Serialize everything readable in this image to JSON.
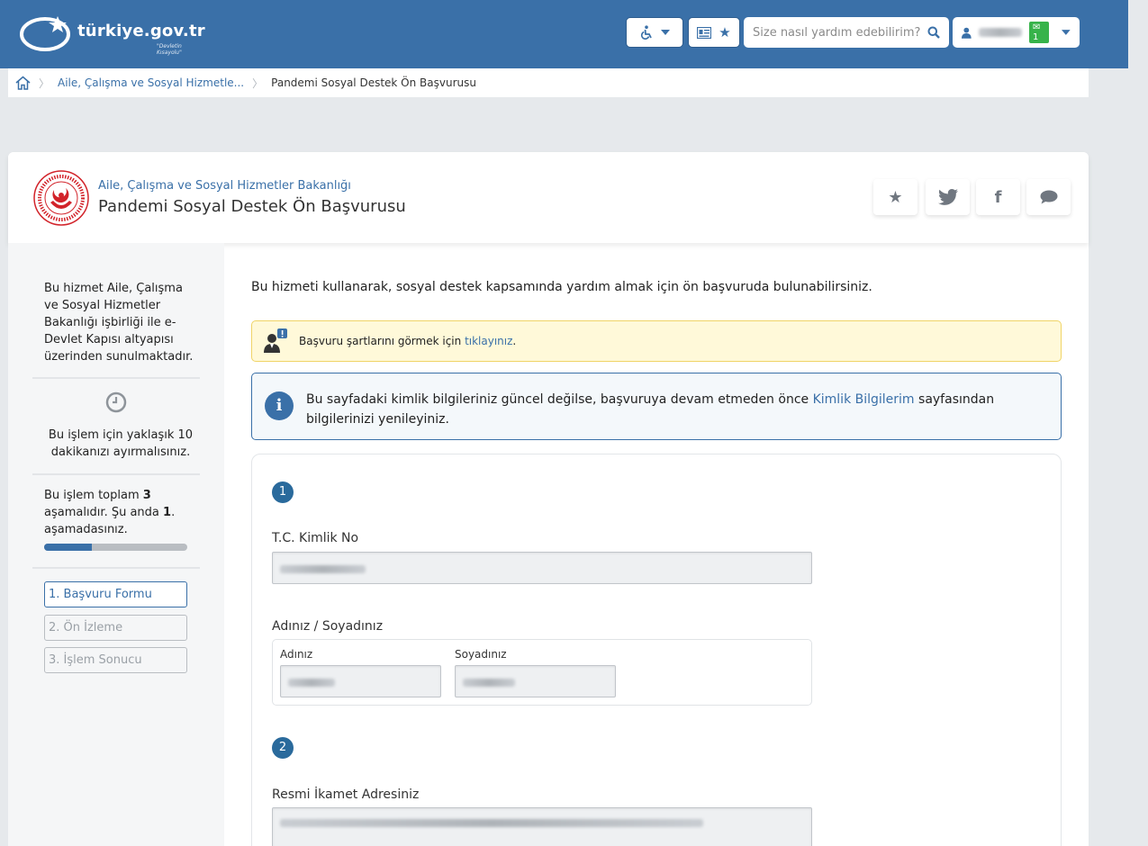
{
  "header": {
    "logo_text": "türkiye.gov.tr",
    "logo_sub": "\"Devletin Kısayolu\"",
    "accessibility_icon": "wheelchair-icon",
    "search_placeholder": "Size nasıl yardım edebilirim?",
    "message_count": "1"
  },
  "breadcrumb": {
    "items": [
      "Aile, Çalışma ve Sosyal Hizmetle...",
      "Pandemi Sosyal Destek Ön Başvurusu"
    ]
  },
  "service": {
    "ministry": "Aile, Çalışma ve Sosyal Hizmetler Bakanlığı",
    "title": "Pandemi Sosyal Destek Ön Başvurusu"
  },
  "sidebar": {
    "about": "Bu hizmet Aile, Çalışma ve Sosyal Hizmetler Bakanlığı işbirliği ile e-Devlet Kapısı altyapısı üzerinden sunulmaktadır.",
    "duration": "Bu işlem için yaklaşık 10 dakikanızı ayırmalısınız.",
    "steps_text_a": "Bu işlem toplam ",
    "steps_total": "3",
    "steps_text_b": " aşamalıdır. Şu anda ",
    "steps_current": "1",
    "steps_text_c": ". aşamadasınız.",
    "progress_fraction": 0.333,
    "steps": [
      "1. Başvuru Formu",
      "2. Ön İzleme",
      "3. İşlem Sonucu"
    ]
  },
  "main": {
    "intro": "Bu hizmeti kullanarak, sosyal destek kapsamında yardım almak için ön başvuruda bulunabilirsiniz.",
    "warning_text": "Başvuru şartlarını görmek için ",
    "warning_link": "tıklayınız",
    "warning_end": ".",
    "info_text_a": "Bu sayfadaki kimlik bilgileriniz güncel değilse, başvuruya devam etmeden önce ",
    "info_link": "Kimlik Bilgilerim",
    "info_text_b": " sayfasından bilgilerinizi yenileyiniz."
  },
  "form": {
    "section1": "1",
    "tc_label": "T.C. Kimlik No",
    "name_group_label": "Adınız / Soyadınız",
    "first_name_label": "Adınız",
    "last_name_label": "Soyadınız",
    "section2": "2",
    "address_label": "Resmi İkamet Adresiniz"
  },
  "colors": {
    "brand": "#3a70a8",
    "warning_bg": "#fff9d9",
    "progress_fill": "#3a70a8"
  }
}
